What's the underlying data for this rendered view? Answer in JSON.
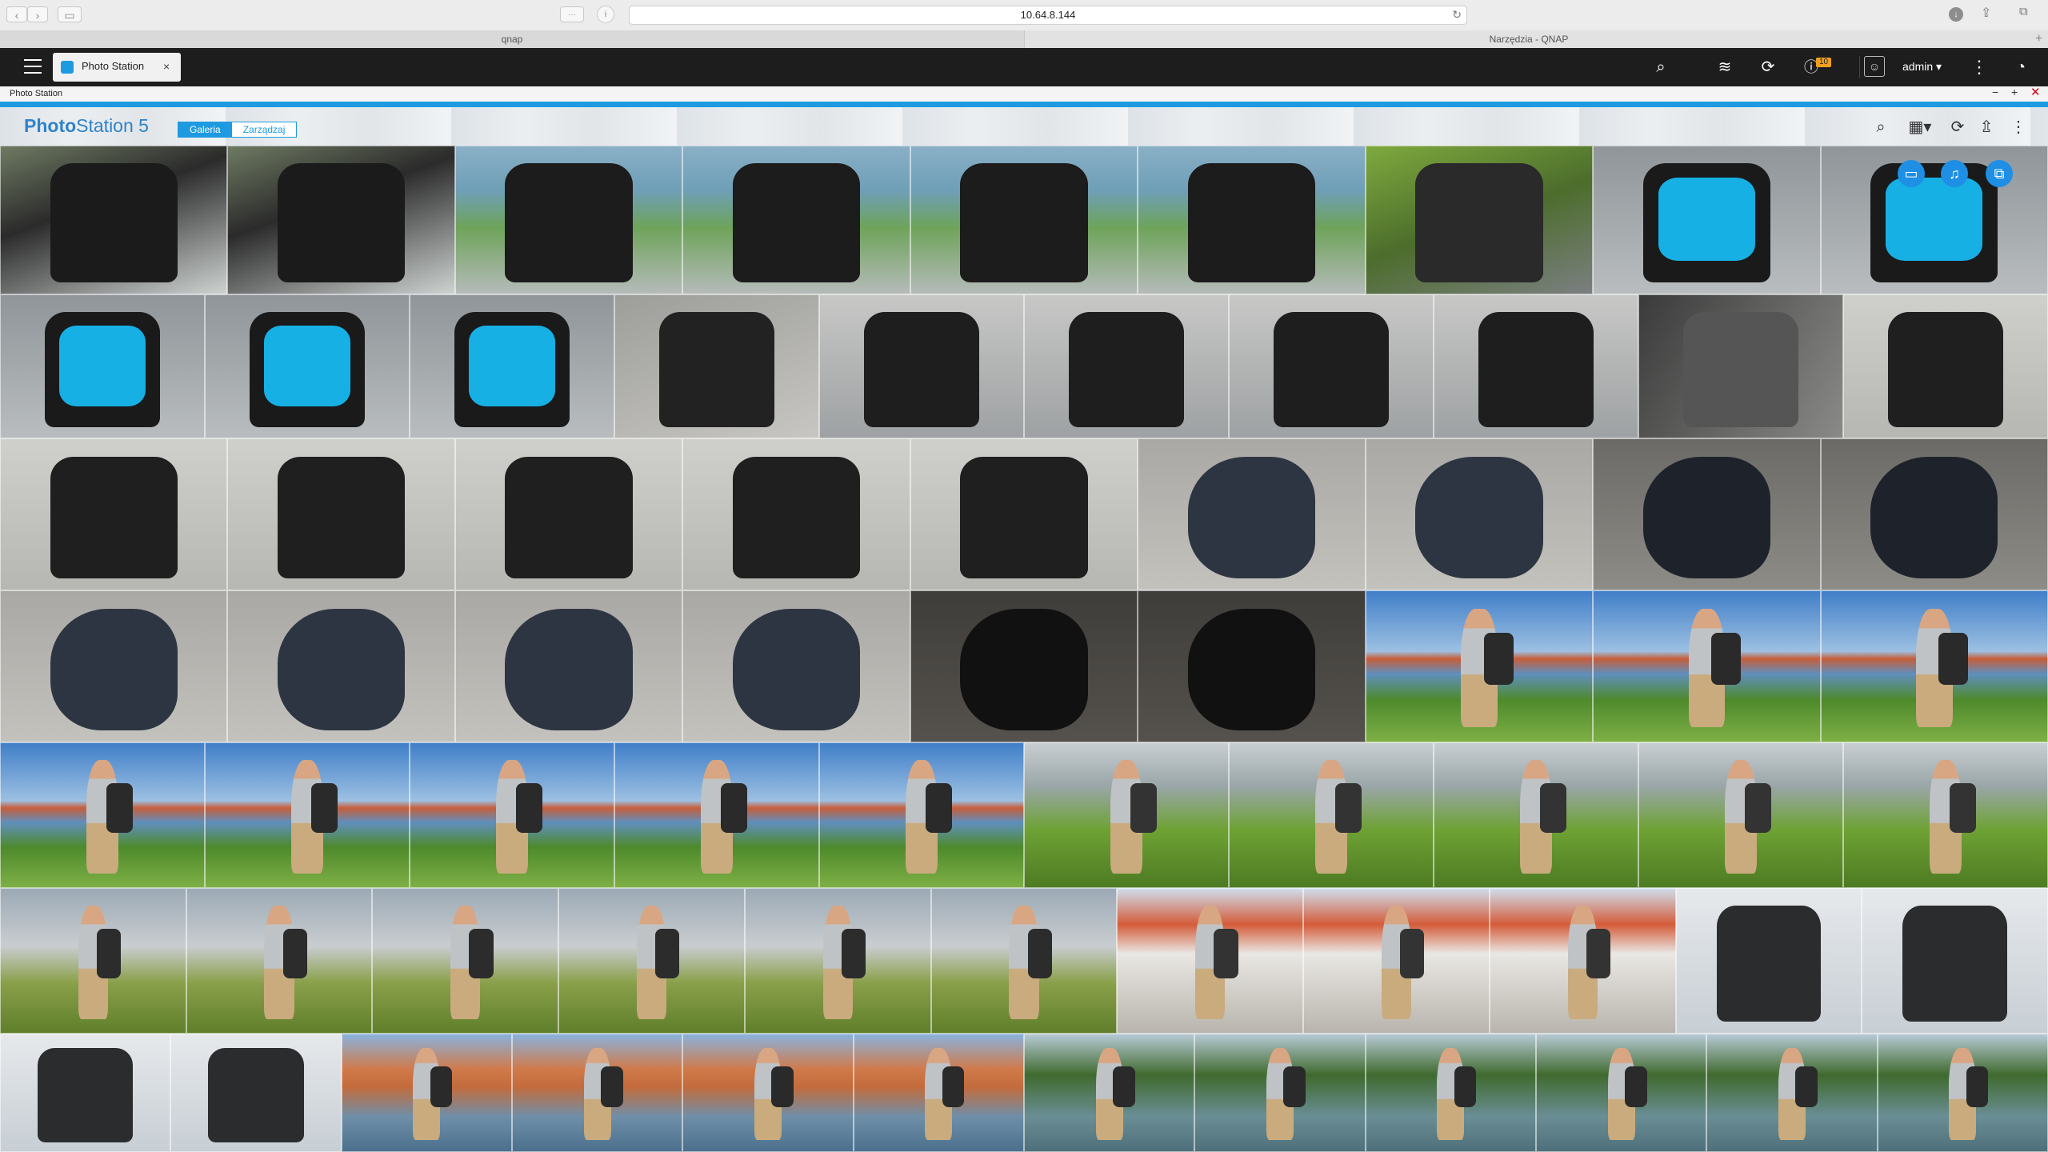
{
  "browser": {
    "url": "10.64.8.144",
    "tabs": [
      "qnap",
      "Narzędzia - QNAP"
    ]
  },
  "topbar": {
    "app_tab_label": "Photo Station",
    "notification_count": "10",
    "user": "admin ▾"
  },
  "window": {
    "title": "Photo Station"
  },
  "header": {
    "logo_bold": "Photo",
    "logo_light": "Station 5",
    "mode_tabs": [
      {
        "label": "Galeria",
        "active": true
      },
      {
        "label": "Zarządzaj",
        "active": false
      }
    ]
  },
  "gallery": {
    "rows": [
      [
        "backpack-pocket",
        "backpack-pocket",
        "backpack-river",
        "backpack-river",
        "backpack-river",
        "backpack-river",
        "camera-bag-open",
        "camera-bag-blue",
        "camera-bag-blue"
      ],
      [
        "camera-bag-blue",
        "camera-bag-blue",
        "camera-bag-blue",
        "camera-bag-concrete",
        "backpack-hand",
        "backpack-hand",
        "backpack-hand",
        "backpack-hand",
        "concrete-closeup",
        "backpack-concrete"
      ],
      [
        "backpack-concrete",
        "backpack-concrete",
        "backpack-concrete",
        "backpack-concrete",
        "backpack-concrete",
        "raincover",
        "raincover",
        "raincover-dark",
        "raincover-dark"
      ],
      [
        "raincover",
        "raincover",
        "raincover",
        "raincover",
        "raincover-shadow",
        "raincover-shadow",
        "man-river",
        "man-river",
        "man-river"
      ],
      [
        "man-river",
        "man-river",
        "man-river",
        "man-river",
        "man-river",
        "man-grass",
        "man-grass",
        "man-grass",
        "man-grass",
        "man-grass"
      ],
      [
        "man-wall",
        "man-wall",
        "man-wall",
        "man-wall",
        "man-wall",
        "man-wall",
        "man-square",
        "man-square",
        "man-square",
        "backpack-closeup",
        "backpack-closeup"
      ],
      [
        "backpack-closeup",
        "backpack-closeup",
        "man-city",
        "man-city",
        "man-city",
        "man-city",
        "man-trees",
        "man-trees",
        "man-trees",
        "man-trees",
        "man-trees",
        "man-trees"
      ]
    ]
  },
  "colors": {
    "accent": "#1e9ae0",
    "topbar": "#1d1d1d",
    "bag_interior": "#17b0e4"
  },
  "icons": [
    "back-icon",
    "forward-icon",
    "sidebar-icon",
    "reader-icon",
    "info-icon",
    "reload-icon",
    "download-icon",
    "share-icon",
    "tabs-icon",
    "menu-icon",
    "search-icon",
    "stack-icon",
    "sync-icon",
    "notification-icon",
    "user-icon",
    "more-icon",
    "dashboard-icon",
    "minimize-icon",
    "maximize-icon",
    "close-icon",
    "grid-view-icon",
    "refresh-icon",
    "upload-icon",
    "slideshow-icon",
    "music-icon",
    "copy-icon"
  ]
}
